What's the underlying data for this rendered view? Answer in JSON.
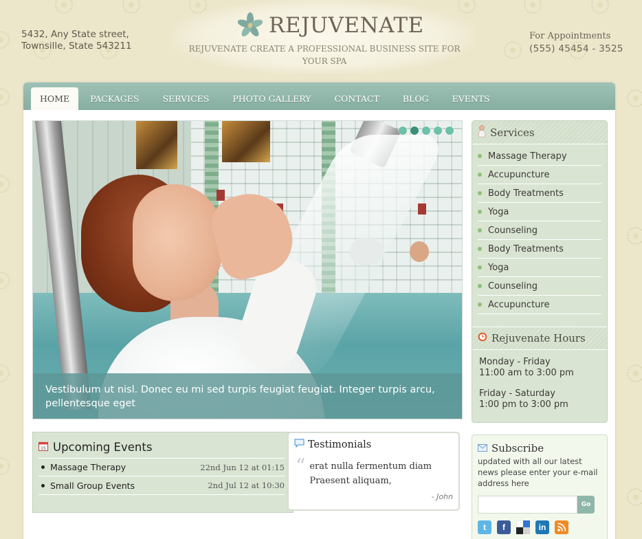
{
  "header": {
    "address_line1": "5432, Any State street,",
    "address_line2": "Townsille, State 543211",
    "logo_text": "REJUVENATE",
    "tagline": "REJUVENATE CREATE A PROFESSIONAL BUSINESS SITE FOR YOUR SPA",
    "appointments_label": "For Appointments",
    "phone": "(555) 45454 - 3525"
  },
  "nav": {
    "items": [
      {
        "label": "HOME",
        "active": true
      },
      {
        "label": "PACKAGES"
      },
      {
        "label": "SERVICES"
      },
      {
        "label": "PHOTO GALLERY"
      },
      {
        "label": "CONTACT"
      },
      {
        "label": "BLOG"
      },
      {
        "label": "EVENTS"
      }
    ]
  },
  "slider": {
    "caption": "Vestibulum ut nisl. Donec eu mi sed turpis feugiat feugiat. Integer turpis arcu, pellentesque eget",
    "dot_count": 5,
    "active_dot": 2
  },
  "services": {
    "title": "Services",
    "items": [
      "Massage Therapy",
      "Accupuncture",
      "Body Treatments",
      "Yoga",
      "Counseling",
      "Body Treatments",
      "Yoga",
      "Counseling",
      "Accupuncture"
    ]
  },
  "hours": {
    "title": "Rejuvenate Hours",
    "blocks": [
      {
        "days": "Monday - Friday",
        "time": "11:00 am to 3:00 pm"
      },
      {
        "days": "Friday - Saturday",
        "time": "1:00 pm to 3:00 pm"
      }
    ]
  },
  "events": {
    "title": "Upcoming Events",
    "rows": [
      {
        "name": "Massage Therapy",
        "date": "22nd Jun 12 at 01:15"
      },
      {
        "name": "Small Group Events",
        "date": "2nd Jul 12 at 10:30"
      }
    ]
  },
  "testimonials": {
    "title": "Testimonials",
    "quote": "erat nulla fermentum diam Praesent aliquam,",
    "author": "- John"
  },
  "subscribe": {
    "title": "Subscribe",
    "text": "updated with all our latest news please enter your e-mail address here",
    "button": "Go",
    "social": [
      "twitter-icon",
      "facebook-icon",
      "delicious-icon",
      "linkedin-icon",
      "rss-icon"
    ]
  },
  "colors": {
    "background": "#ece6cb",
    "nav": "#9ec2b6",
    "sidebar": "#d9e4d2",
    "accent": "#8fb7a9"
  }
}
